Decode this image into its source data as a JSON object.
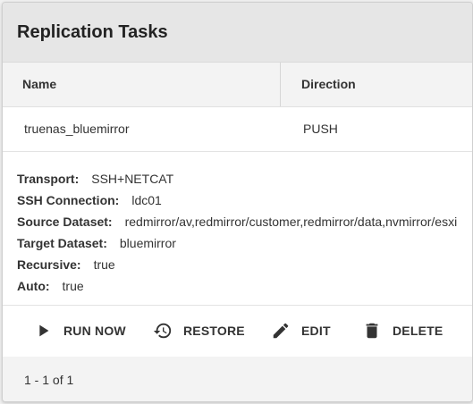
{
  "card": {
    "title": "Replication Tasks"
  },
  "table": {
    "columns": {
      "name": "Name",
      "direction": "Direction"
    },
    "row": {
      "name": "truenas_bluemirror",
      "direction": "PUSH"
    }
  },
  "details": [
    {
      "label": "Transport:",
      "value": "SSH+NETCAT"
    },
    {
      "label": "SSH Connection:",
      "value": "ldc01"
    },
    {
      "label": "Source Dataset:",
      "value": "redmirror/av,redmirror/customer,redmirror/data,nvmirror/esxi"
    },
    {
      "label": "Target Dataset:",
      "value": "bluemirror"
    },
    {
      "label": "Recursive:",
      "value": "true"
    },
    {
      "label": "Auto:",
      "value": "true"
    }
  ],
  "actions": {
    "run_now": "RUN NOW",
    "restore": "RESTORE",
    "edit": "EDIT",
    "delete": "DELETE"
  },
  "icons": {
    "run_now": "play-icon",
    "restore": "history-icon",
    "edit": "pencil-icon",
    "delete": "trash-icon"
  },
  "paginator": {
    "range_label": "1 - 1 of 1"
  },
  "colors": {
    "icon": "#333333",
    "header_bg": "#e6e6e6",
    "footer_bg": "#f3f3f3"
  }
}
